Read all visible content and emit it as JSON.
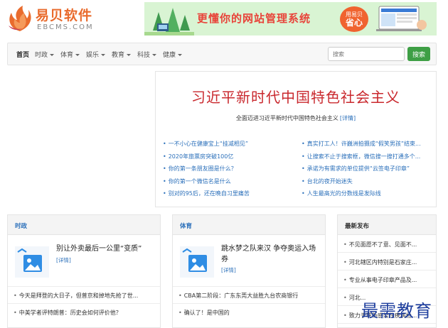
{
  "logo": {
    "title": "易贝软件",
    "subtitle": "EBCMS.COM"
  },
  "banner": {
    "text": "更懂你的网站管理系统",
    "badge_top": "用易贝",
    "badge_main": "省心"
  },
  "nav": {
    "items": [
      {
        "label": "首页",
        "dropdown": false,
        "active": true
      },
      {
        "label": "时政",
        "dropdown": true
      },
      {
        "label": "体育",
        "dropdown": true
      },
      {
        "label": "娱乐",
        "dropdown": true
      },
      {
        "label": "教育",
        "dropdown": true
      },
      {
        "label": "科技",
        "dropdown": true
      },
      {
        "label": "健康",
        "dropdown": true
      }
    ],
    "search_placeholder": "搜索",
    "search_button": "搜索"
  },
  "hero": {
    "title": "习近平新时代中国特色社会主义",
    "subtitle": "全面迈进习近平新时代中国特色社会主义",
    "more": "[详情]",
    "left_links": [
      "一不小心在健康宝上“挂减相见”",
      "2020年旅票房突破100亿",
      "你的第一条朋友圈是什么？",
      "你的第一个微信名是什么",
      "别对的95后，还在晚自习里痛苦"
    ],
    "right_links": [
      "真实打工人！许巍洲拍摄成“假笑男孩”结束...",
      "让搜索不止于搜索框，微信搜一搜打通多个...",
      "承诺为有需求的单位提供“云签电子印章”",
      "台北的夜开始迷失",
      "人生最高光的分数线是发际线"
    ]
  },
  "panel_politics": {
    "heading": "时政",
    "feature_title": "别让外卖最后一公里“变质”",
    "feature_more": "[详情]",
    "items": [
      "今天是拜登的大日子，但普京和掉地先抢了世...",
      "中美学者评特朗普：历史会如何评价他？"
    ]
  },
  "panel_sports": {
    "heading": "体育",
    "feature_title": "跳水梦之队来汉 争夺奥运入场券",
    "feature_more": "[详情]",
    "items": [
      "CBA第二阶段：广东东莞大益胜九台农商银行",
      "确认了！是中国的"
    ]
  },
  "panel_latest": {
    "heading": "最新发布",
    "items": [
      "不见面愿不了意、见面不...",
      "河北辖区内特别是石家庄...",
      "专业从事电子印章产品及...",
      "河北...",
      "致力于革新感染性疾病检..."
    ]
  },
  "watermark": "最需教育"
}
